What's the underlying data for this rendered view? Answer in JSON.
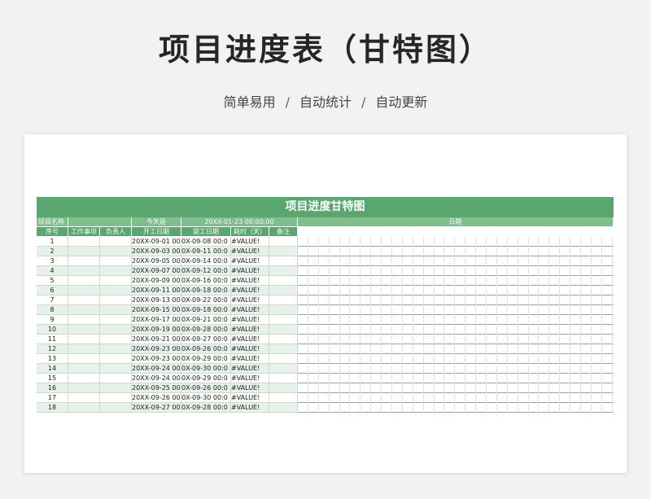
{
  "title": "项目进度表（甘特图）",
  "subtitle": {
    "part1": "简单易用",
    "separator": "/",
    "part2": "自动统计",
    "part3": "自动更新"
  },
  "sheet": {
    "title": "项目进度甘特图",
    "info": {
      "project_name_label": "项目名称",
      "today_label": "今天是",
      "today_value": "20XX-01-23 00:00:00",
      "date_label": "日期"
    },
    "headers": {
      "seq": "序号",
      "task": "工作事项",
      "owner": "负责人",
      "start": "开工日期",
      "end": "竣工日期",
      "duration": "耗时（天）",
      "note": "备注",
      "day_placeholder": "#"
    },
    "rows": [
      {
        "seq": "1",
        "start": "20XX-09-01 00:0",
        "end": "0X-09-08 00:0",
        "duration": "#VALUE!"
      },
      {
        "seq": "2",
        "start": "20XX-09-03 00:0",
        "end": "0X-09-11 00:0",
        "duration": "#VALUE!"
      },
      {
        "seq": "3",
        "start": "20XX-09-05 00:0",
        "end": "0X-09-14 00:0",
        "duration": "#VALUE!"
      },
      {
        "seq": "4",
        "start": "20XX-09-07 00:0",
        "end": "0X-09-12 00:0",
        "duration": "#VALUE!"
      },
      {
        "seq": "5",
        "start": "20XX-09-09 00:0",
        "end": "0X-09-16 00:0",
        "duration": "#VALUE!"
      },
      {
        "seq": "6",
        "start": "20XX-09-11 00:0",
        "end": "0X-09-18 00:0",
        "duration": "#VALUE!"
      },
      {
        "seq": "7",
        "start": "20XX-09-13 00:0",
        "end": "0X-09-22 00:0",
        "duration": "#VALUE!"
      },
      {
        "seq": "8",
        "start": "20XX-09-15 00:0",
        "end": "0X-09-18 00:0",
        "duration": "#VALUE!"
      },
      {
        "seq": "9",
        "start": "20XX-09-17 00:0",
        "end": "0X-09-21 00:0",
        "duration": "#VALUE!"
      },
      {
        "seq": "10",
        "start": "20XX-09-19 00:0",
        "end": "0X-09-28 00:0",
        "duration": "#VALUE!"
      },
      {
        "seq": "11",
        "start": "20XX-09-21 00:0",
        "end": "0X-09-27 00:0",
        "duration": "#VALUE!"
      },
      {
        "seq": "12",
        "start": "20XX-09-23 00:0",
        "end": "0X-09-26 00:0",
        "duration": "#VALUE!"
      },
      {
        "seq": "13",
        "start": "20XX-09-23 00:0",
        "end": "0X-09-29 00:0",
        "duration": "#VALUE!"
      },
      {
        "seq": "14",
        "start": "20XX-09-24 00:0",
        "end": "0X-09-30 00:0",
        "duration": "#VALUE!"
      },
      {
        "seq": "15",
        "start": "20XX-09-24 00:0",
        "end": "0X-09-29 00:0",
        "duration": "#VALUE!"
      },
      {
        "seq": "16",
        "start": "20XX-09-25 00:0",
        "end": "0X-09-26 00:0",
        "duration": "#VALUE!"
      },
      {
        "seq": "17",
        "start": "20XX-09-26 00:0",
        "end": "0X-09-30 00:0",
        "duration": "#VALUE!"
      },
      {
        "seq": "18",
        "start": "20XX-09-27 00:0",
        "end": "0X-09-28 00:0",
        "duration": "#VALUE!"
      }
    ],
    "colors": {
      "header_green": "#59a66f",
      "info_green": "#7fbc8e",
      "stripe_green": "#e6f1e8"
    }
  }
}
